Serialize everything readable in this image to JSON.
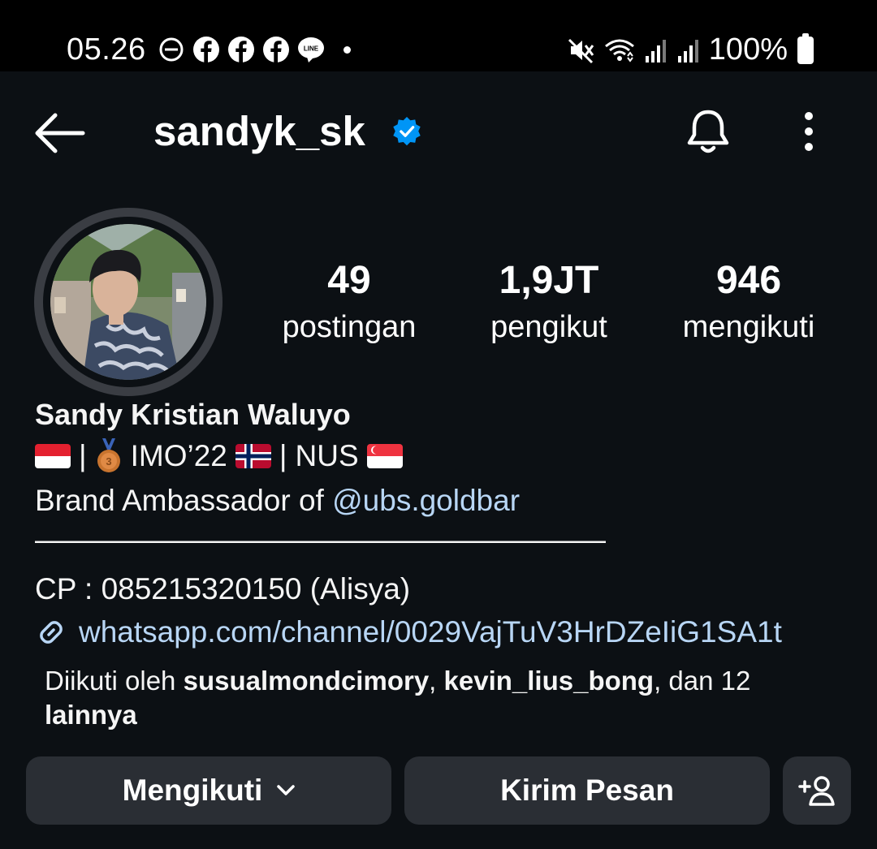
{
  "status_bar": {
    "time": "05.26",
    "battery": "100%",
    "icons_left": [
      "do-not-disturb-icon",
      "facebook-icon",
      "facebook-icon",
      "facebook-icon",
      "line-icon",
      "dot-icon"
    ],
    "icons_right": [
      "mute-icon",
      "wifi-icon",
      "signal-icon",
      "signal-icon",
      "battery-icon"
    ]
  },
  "header": {
    "username": "sandyk_sk",
    "verified": true,
    "icons": [
      "back-arrow-icon",
      "verified-badge-icon",
      "bell-icon",
      "more-vertical-icon"
    ]
  },
  "profile": {
    "avatar_alt": "profile picture",
    "stats": {
      "posts_count": "49",
      "posts_label": "postingan",
      "followers_count": "1,9JT",
      "followers_label": "pengikut",
      "following_count": "946",
      "following_label": "mengikuti"
    }
  },
  "bio": {
    "name": "Sandy Kristian Waluyo",
    "sep1": "|",
    "imo": "IMO’22",
    "sep2": "|",
    "nus": "NUS",
    "brand_prefix": "Brand Ambassador of",
    "brand_mention": "@ubs.goldbar",
    "divider": "———————————————————",
    "cp": "CP : 085215320150 (Alisya)",
    "url": "whatsapp.com/channel/0029VajTuV3HrDZeIiG1SA1t"
  },
  "followed_by": {
    "prefix": "Diikuti oleh",
    "user1": "susualmondcimory",
    "comma": ",",
    "user2": "kevin_lius_bong",
    "middle": ", dan 12",
    "suffix": "lainnya"
  },
  "actions": {
    "follow_label": "Mengikuti",
    "message_label": "Kirim Pesan"
  },
  "colors": {
    "background": "#0c1014",
    "button": "#2a2e34",
    "link": "#b8d6f5",
    "verified": "#0095f6"
  }
}
